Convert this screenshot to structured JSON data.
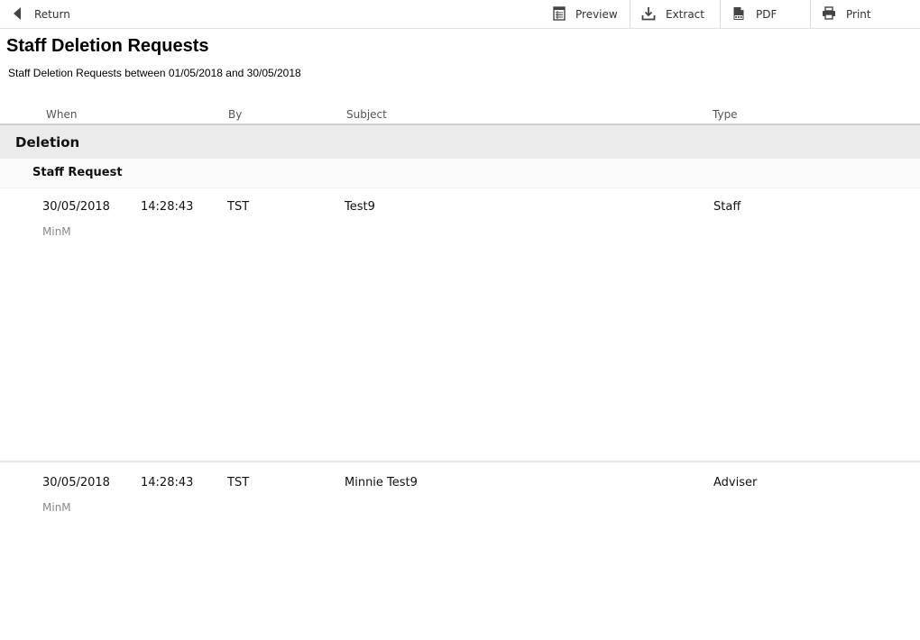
{
  "toolbar": {
    "return_label": "Return",
    "preview_label": "Preview",
    "extract_label": "Extract",
    "pdf_label": "PDF",
    "print_label": "Print"
  },
  "report": {
    "title": "Staff Deletion Requests",
    "subtitle": "Staff Deletion Requests between 01/05/2018 and 30/05/2018"
  },
  "columns": {
    "when": "When",
    "by": "By",
    "subject": "Subject",
    "type": "Type"
  },
  "group": {
    "label": "Deletion",
    "subgroup_label": "Staff Request"
  },
  "records": [
    {
      "date": "30/05/2018",
      "time": "14:28:43",
      "by": "TST",
      "subject": "Test9",
      "type": "Staff",
      "user": "MinM"
    },
    {
      "date": "30/05/2018",
      "time": "14:28:43",
      "by": "TST",
      "subject": "Minnie Test9",
      "type": "Adviser",
      "user": "MinM"
    }
  ]
}
